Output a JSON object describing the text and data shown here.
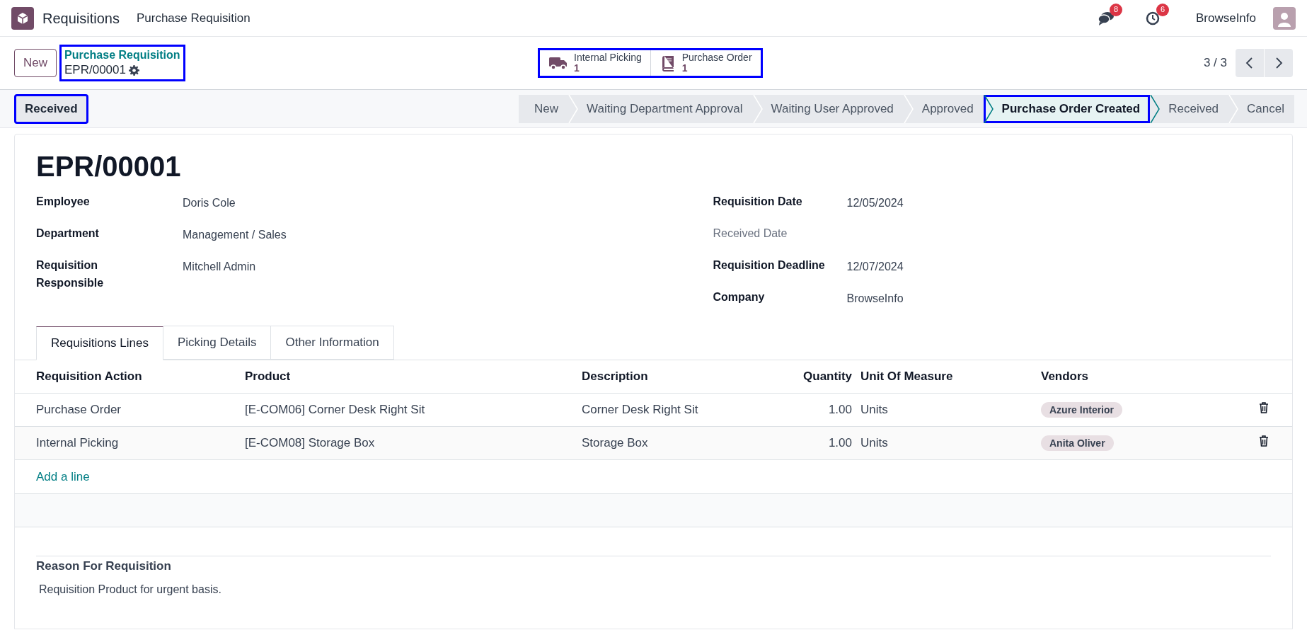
{
  "navbar": {
    "app_name": "Requisitions",
    "menu": [
      "Purchase Requisition"
    ],
    "messages_badge": "8",
    "activities_badge": "6",
    "company": "BrowseInfo"
  },
  "control_panel": {
    "new_button": "New",
    "breadcrumb": "Purchase Requisition",
    "record": "EPR/00001",
    "breadcrumb_highlighted": true,
    "smart_buttons": [
      {
        "kind": "truck",
        "label": "Internal Picking",
        "count": "1"
      },
      {
        "kind": "book",
        "label": "Purchase Order",
        "count": "1"
      }
    ],
    "smart_buttons_highlighted": true,
    "pager": "3 / 3"
  },
  "status_bar": {
    "action_button": "Received",
    "action_highlighted": true,
    "stages": [
      {
        "label": "New",
        "selected": false,
        "highlighted": false
      },
      {
        "label": "Waiting Department Approval",
        "selected": false,
        "highlighted": false
      },
      {
        "label": "Waiting User Approved",
        "selected": false,
        "highlighted": false
      },
      {
        "label": "Approved",
        "selected": false,
        "highlighted": false
      },
      {
        "label": "Purchase Order Created",
        "selected": true,
        "highlighted": true
      },
      {
        "label": "Received",
        "selected": false,
        "highlighted": false
      },
      {
        "label": "Cancel",
        "selected": false,
        "highlighted": false
      }
    ]
  },
  "form": {
    "title": "EPR/00001",
    "left_fields": [
      {
        "label": "Employee",
        "value": "Doris Cole"
      },
      {
        "label": "Department",
        "value": "Management / Sales"
      },
      {
        "label": "Requisition Responsible",
        "value": "Mitchell Admin"
      }
    ],
    "right_fields": [
      {
        "label": "Requisition Date",
        "value": "12/05/2024",
        "required": true
      },
      {
        "label": "Received Date",
        "required": false
      },
      {
        "label": "Requisition Deadline",
        "value": "12/07/2024",
        "required": true
      },
      {
        "label": "Company",
        "value": "BrowseInfo",
        "required": true
      }
    ],
    "tabs": [
      {
        "label": "Requisitions Lines",
        "selected": true
      },
      {
        "label": "Picking Details",
        "selected": false
      },
      {
        "label": "Other Information",
        "selected": false
      }
    ],
    "table": {
      "columns": [
        "Requisition Action",
        "Product",
        "Description",
        "Quantity",
        "Unit Of Measure",
        "Vendors"
      ],
      "rows": [
        {
          "action": "Purchase Order",
          "product": "[E-COM06] Corner Desk Right Sit",
          "description": "Corner Desk Right Sit",
          "quantity": "1.00",
          "uom": "Units",
          "vendor": "Azure Interior"
        },
        {
          "action": "Internal Picking",
          "product": "[E-COM08] Storage Box",
          "description": "Storage Box",
          "quantity": "1.00",
          "uom": "Units",
          "vendor": "Anita Oliver"
        }
      ],
      "add_line": "Add a line"
    },
    "reason_label": "Reason For Requisition",
    "reason": "Requisition Product for urgent basis."
  }
}
